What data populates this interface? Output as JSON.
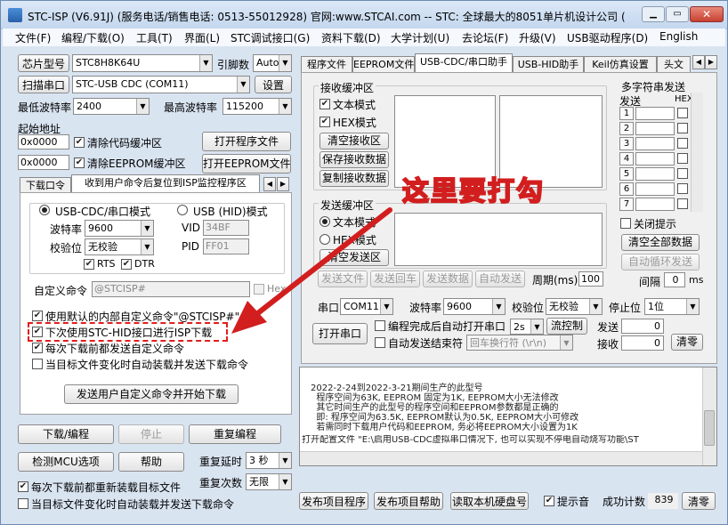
{
  "window": {
    "title": "STC-ISP (V6.91J) (服务电话/销售电话: 0513-55012928) 官网:www.STCAI.com  -- STC: 全球最大的8051单片机设计公司 (",
    "controls": [
      "minimize-icon",
      "maximize-icon",
      "close-icon"
    ]
  },
  "menu": [
    "文件(F)",
    "编程/下载(O)",
    "工具(T)",
    "界面(L)",
    "STC调试接口(G)",
    "资料下载(D)",
    "大学计划(U)",
    "去论坛(F)",
    "升级(V)",
    "USB驱动程序(D)",
    "English"
  ],
  "left": {
    "chip_btn": "芯片型号",
    "chip_value": "STC8H8K64U",
    "pins_label": "引脚数",
    "pins_value": "Auto",
    "scan_btn": "扫描串口",
    "port_value": "STC-USB CDC (COM11)",
    "settings_btn": "设置",
    "min_baud_label": "最低波特率",
    "min_baud": "2400",
    "max_baud_label": "最高波特率",
    "max_baud": "115200",
    "start_addr_label": "起始地址",
    "code_addr": "0x0000",
    "clear_code": "清除代码缓冲区",
    "open_prog": "打开程序文件",
    "eeprom_addr": "0x0000",
    "clear_eeprom": "清除EEPROM缓冲区",
    "open_eeprom": "打开EEPROM文件",
    "tabs": [
      "下载口令",
      "收到用户命令后复位到ISP监控程序区"
    ],
    "usb_cdc_mode": "USB-CDC/串口模式",
    "usb_hid_mode": "USB (HID)模式",
    "baud_label": "波特率",
    "baud_value": "9600",
    "vid_label": "VID",
    "vid_value": "34BF",
    "parity_label": "校验位",
    "parity_value": "无校验",
    "pid_label": "PID",
    "pid_value": "FF01",
    "rts": "RTS",
    "dtr": "DTR",
    "custom_cmd_label": "自定义命令",
    "custom_cmd_value": "@STCISP#",
    "hex_label": "Hex",
    "opt1": "使用默认的内部自定义命令\"@STCISP#\"",
    "opt2": "下次使用STC-HID接口进行ISP下载",
    "opt3": "每次下载前都发送自定义命令",
    "opt4": "当目标文件变化时自动装载并发送下载命令",
    "send_custom_btn": "发送用户自定义命令并开始下载",
    "download_btn": "下载/编程",
    "stop_btn": "停止",
    "reprogram_btn": "重复编程",
    "check_mcu_btn": "检测MCU选项",
    "help_btn": "帮助",
    "repeat_delay_label": "重复延时",
    "repeat_delay_value": "3 秒",
    "repeat_count_label": "重复次数",
    "repeat_count_value": "无限",
    "reload_each": "每次下载前都重新装载目标文件",
    "auto_reload": "当目标文件变化时自动装载并发送下载命令"
  },
  "annotation": {
    "text": "这里要打勾"
  },
  "right": {
    "tabs": [
      "程序文件",
      "EEPROM文件",
      "USB-CDC/串口助手",
      "USB-HID助手",
      "Keil仿真设置",
      "头文"
    ],
    "recv_label": "接收缓冲区",
    "text_mode": "文本模式",
    "hex_mode": "HEX模式",
    "clear_recv": "清空接收区",
    "save_recv": "保存接收数据",
    "copy_recv": "复制接收数据",
    "send_label": "发送缓冲区",
    "send_text": "文本模式",
    "send_hex": "HEX模式",
    "clear_send": "清空发送区",
    "send_file": "发送文件",
    "send_enter": "发送回车",
    "send_data": "发送数据",
    "auto_send": "自动发送",
    "period_label": "周期(ms)",
    "period_value": "100",
    "multi_label": "多字符串发送",
    "send_col": "发送",
    "hex_col": "HEX",
    "rows": [
      "1",
      "2",
      "3",
      "4",
      "5",
      "6",
      "7"
    ],
    "close_tip": "关闭提示",
    "clear_all": "清空全部数据",
    "auto_loop": "自动循环发送",
    "interval_label": "间隔",
    "interval_value": "0",
    "interval_unit": "ms",
    "port_label": "串口",
    "port_value": "COM11",
    "baud_label": "波特率",
    "baud_value": "9600",
    "parity_label": "校验位",
    "parity_value": "无校验",
    "stop_label": "停止位",
    "stop_value": "1位",
    "open_port": "打开串口",
    "auto_open": "编程完成后自动打开串口",
    "auto_open_val": "2s",
    "flow_ctrl": "流控制",
    "send_count_label": "发送",
    "send_count": "0",
    "auto_send_end": "自动发送结束符",
    "line_end": "回车换行符 (\\r\\n)",
    "recv_count_label": "接收",
    "recv_count": "0",
    "clear_zero": "清零",
    "log": [
      "2022-2-24到2022-3-21期间生产的此型号",
      "  程序空间为63K, EEPROM 固定为1K, EEPROM大小无法修改",
      "  其它时间生产的此型号的程序空间和EEPROM参数都是正确的",
      "  即: 程序空间为63.5K, EEPROM默认为0.5K, EEPROM大小可修改",
      "  若需同时下载用户代码和EEPROM, 务必将EEPROM大小设置为1K",
      "打开配置文件 \"E:\\启用USB-CDC虚拟串口情况下, 也可以实现不停电自动烧写功能\\ST"
    ],
    "publish_prog": "发布项目程序",
    "publish_help": "发布项目帮助",
    "read_disk": "读取本机硬盘号",
    "sound_tip": "提示音",
    "success_label": "成功计数",
    "success_count": "839",
    "clear_btn": "清零"
  }
}
